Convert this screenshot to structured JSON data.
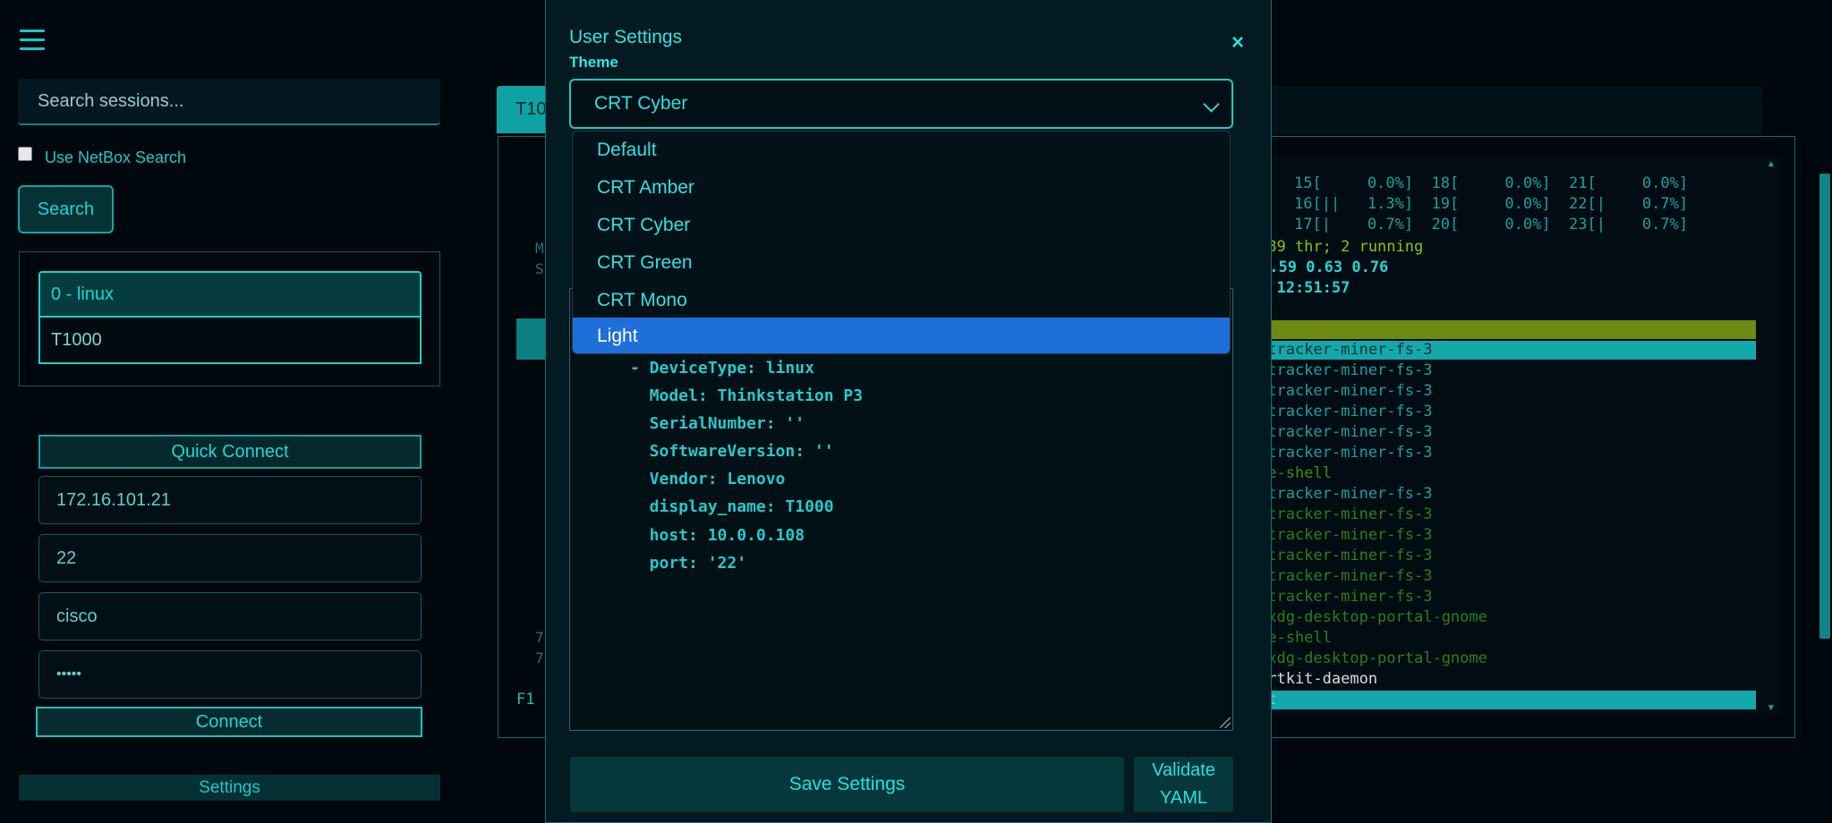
{
  "sidebar": {
    "search_placeholder": "Search sessions...",
    "netbox_label": "Use NetBox Search",
    "search_button": "Search",
    "sessions": [
      "0 - linux",
      "T1000"
    ],
    "quick_connect": {
      "title": "Quick Connect",
      "host": "172.16.101.21",
      "port": "22",
      "username": "cisco",
      "password_mask": "•••••",
      "connect_button": "Connect"
    },
    "settings_button": "Settings"
  },
  "terminal": {
    "tab_label": "T1000",
    "left_fragments": [
      "M",
      "S",
      "7",
      "7",
      "F1"
    ],
    "cpu_rows": [
      "15[     0.0%]  18[     0.0%]  21[     0.0%]",
      "16[||   1.3%]  19[     0.0%]  22[|    0.7%]",
      "17[|    0.7%]  20[     0.0%]  23[|    0.7%]"
    ],
    "tasks_line": "089 thr; 2 running",
    "load_line": "0.59 0.63 0.76",
    "uptime_line": ", 12:51:57",
    "process_lines": [
      "/tracker-miner-fs-3",
      "/tracker-miner-fs-3",
      "/tracker-miner-fs-3",
      "/tracker-miner-fs-3",
      "/tracker-miner-fs-3",
      "/tracker-miner-fs-3",
      "me-shell",
      "/tracker-miner-fs-3",
      "/tracker-miner-fs-3",
      "/tracker-miner-fs-3",
      "/tracker-miner-fs-3",
      "/tracker-miner-fs-3",
      "/tracker-miner-fs-3",
      "/xdg-desktop-portal-gnome",
      "me-shell",
      "/xdg-desktop-portal-gnome",
      "/rtkit-daemon",
      "it"
    ]
  },
  "modal": {
    "title": "User Settings",
    "theme_label": "Theme",
    "close_glyph": "×",
    "selected_theme": "CRT Cyber",
    "theme_options": [
      "Default",
      "CRT Amber",
      "CRT Cyber",
      "CRT Green",
      "CRT Mono",
      "Light"
    ],
    "highlighted_option": "Light",
    "yaml_lines": [
      "- DeviceType: linux",
      "  Model: Thinkstation P3",
      "  SerialNumber: ''",
      "  SoftwareVersion: ''",
      "  Vendor: Lenovo",
      "  display_name: T1000",
      "  host: 10.0.0.108",
      "  port: '22'"
    ],
    "save_button": "Save Settings",
    "validate_button_line1": "Validate",
    "validate_button_line2": "YAML"
  },
  "colors": {
    "background": "#00080d",
    "accent": "#14d2d2",
    "highlight": "#1e6fd9",
    "htop_green_bar": "#6f8a10",
    "htop_cyan_bar": "#14a8aa"
  },
  "icons": {
    "menu": "hamburger-icon",
    "close": "close-icon",
    "dropdown": "chevron-down-icon"
  }
}
